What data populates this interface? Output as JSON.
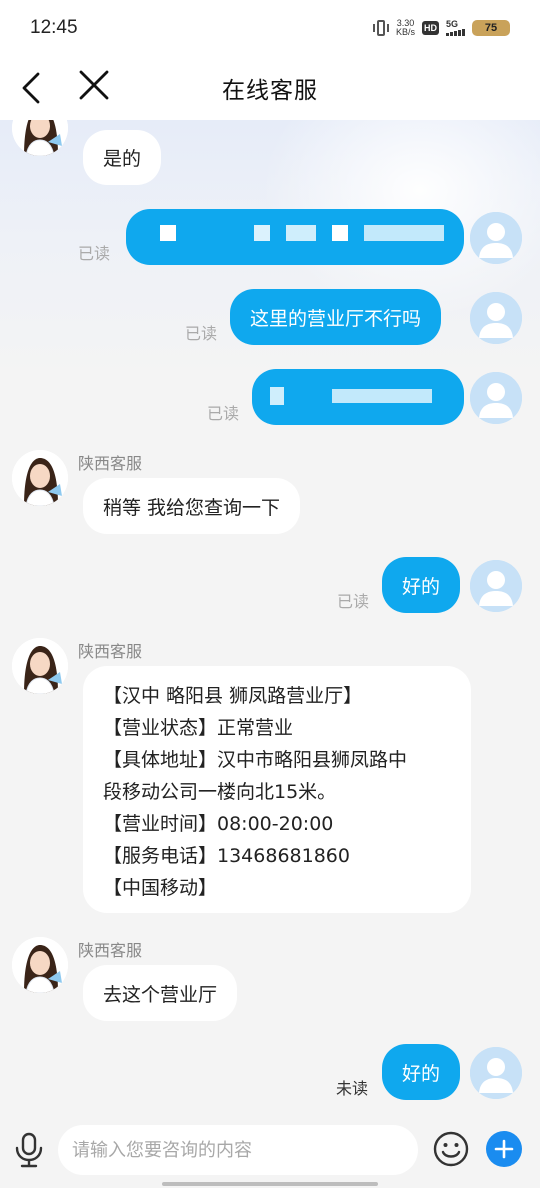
{
  "status_bar": {
    "time": "12:45",
    "net_speed_value": "3.30",
    "net_speed_unit": "KB/s",
    "hd_label": "HD",
    "signal_label": "5G",
    "battery_level": "75"
  },
  "header": {
    "title": "在线客服"
  },
  "messages": [
    {
      "from": "agent",
      "text": "是的"
    },
    {
      "from": "user",
      "text": "",
      "status": "已读"
    },
    {
      "from": "user",
      "text": "这里的营业厅不行吗",
      "status": "已读"
    },
    {
      "from": "user",
      "text": "",
      "status": "已读"
    },
    {
      "from": "agent",
      "sender": "陕西客服",
      "text": "稍等 我给您查询一下"
    },
    {
      "from": "user",
      "text": "好的",
      "status": "已读"
    },
    {
      "from": "agent",
      "sender": "陕西客服",
      "lines": [
        "【汉中 略阳县 狮凤路营业厅】",
        "【营业状态】正常营业",
        "【具体地址】汉中市略阳县狮凤路中",
        "段移动公司一楼向北15米。",
        "【营业时间】08:00-20:00",
        "【服务电话】13468681860",
        "【中国移动】"
      ]
    },
    {
      "from": "agent",
      "sender": "陕西客服",
      "text": "去这个营业厅"
    },
    {
      "from": "user",
      "text": "好的",
      "status": "未读"
    }
  ],
  "input": {
    "placeholder": "请输入您要咨询的内容"
  },
  "colors": {
    "user_bubble": "#0fa8ee",
    "agent_bubble": "#ffffff",
    "plus_button": "#1a8cf0",
    "read_status": "#aaaaaa"
  },
  "icons": [
    "back-icon",
    "close-icon",
    "mic-icon",
    "emoji-icon",
    "plus-icon",
    "agent-avatar",
    "user-avatar"
  ]
}
